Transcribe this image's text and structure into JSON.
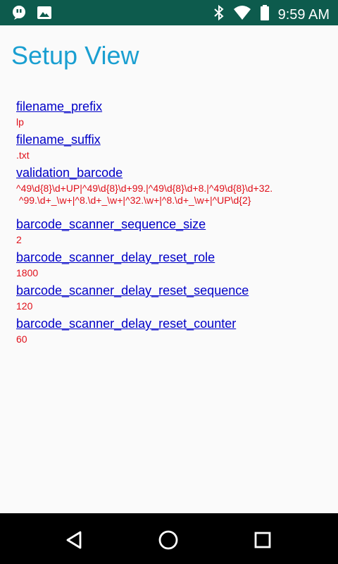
{
  "status_bar": {
    "time": "9:59 AM",
    "icons": [
      "notification-icon",
      "image-icon",
      "bluetooth-icon",
      "wifi-icon",
      "battery-icon"
    ]
  },
  "page": {
    "title": "Setup View"
  },
  "settings": [
    {
      "key": "filename_prefix",
      "value": "lp"
    },
    {
      "key": "filename_suffix",
      "value": ".txt"
    },
    {
      "key": "validation_barcode",
      "value": "^49\\d{8}\\d+UP|^49\\d{8}\\d+99.|^49\\d{8}\\d+8.|^49\\d{8}\\d+32.\n ^99.\\d+_\\w+|^8.\\d+_\\w+|^32.\\w+|^8.\\d+_\\w+|^UP\\d{2}"
    },
    {
      "key": "barcode_scanner_sequence_size",
      "value": "2"
    },
    {
      "key": "barcode_scanner_delay_reset_role",
      "value": "1800"
    },
    {
      "key": "barcode_scanner_delay_reset_sequence",
      "value": "120"
    },
    {
      "key": "barcode_scanner_delay_reset_counter",
      "value": "60"
    }
  ],
  "nav_bar": {
    "icons": [
      "back-icon",
      "home-icon",
      "recents-icon"
    ]
  },
  "colors": {
    "status_bar": "#0d5b4d",
    "title": "#1a9fd1",
    "key_link": "#0000c8",
    "value_text": "#e0101a",
    "nav_bar": "#000000"
  }
}
